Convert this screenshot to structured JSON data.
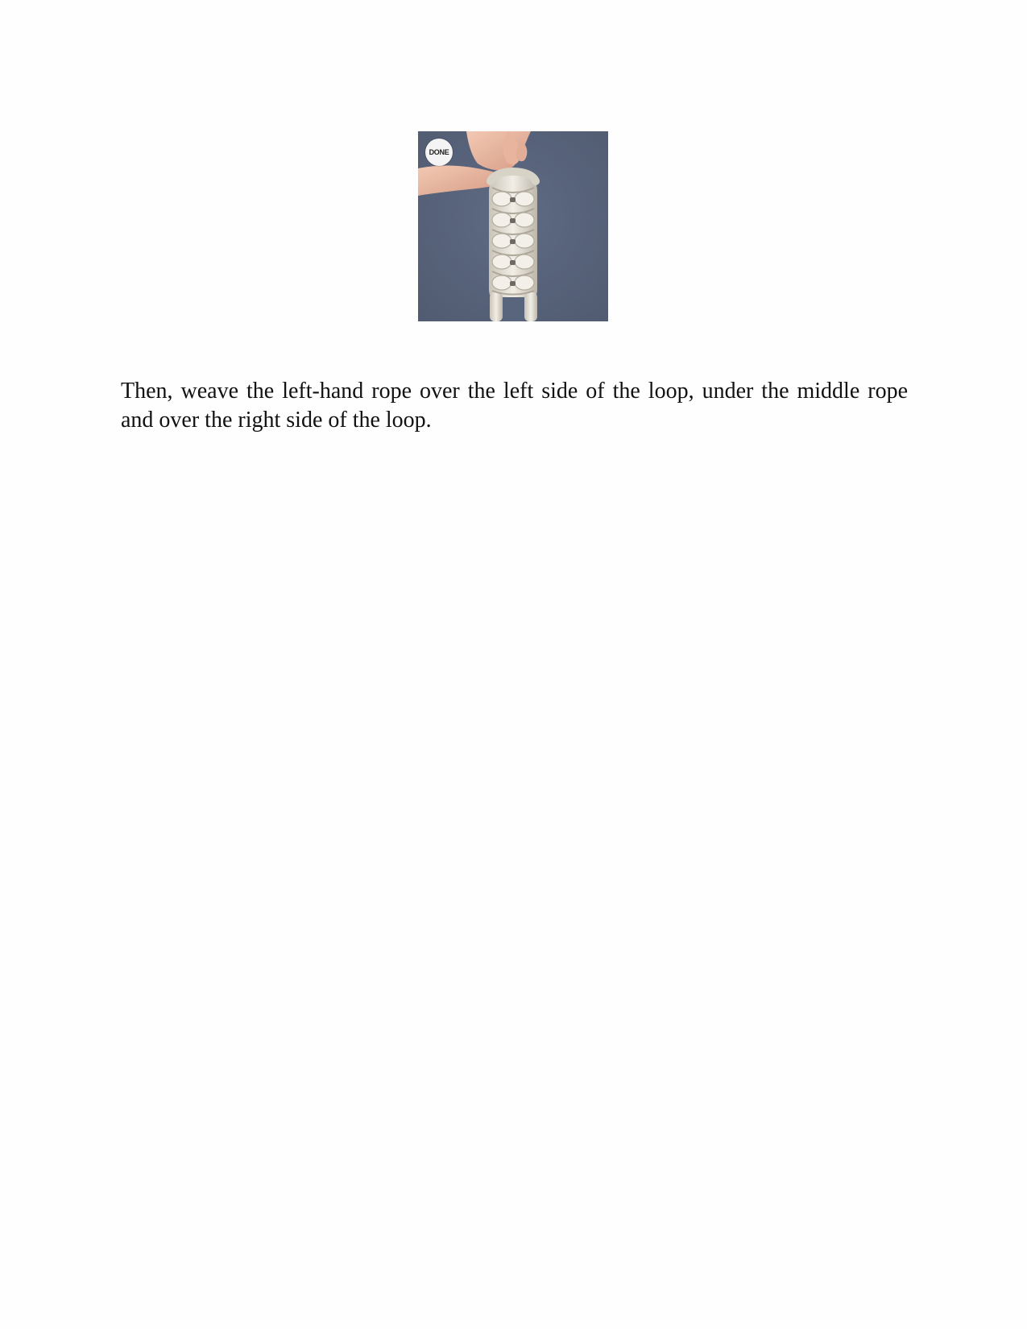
{
  "figure": {
    "badge_label": "DONE",
    "background_color": "#59657d",
    "rope_color": "#e6e2d8"
  },
  "paragraph": {
    "text": "Then, weave the left-hand rope over the left side of the loop, under the middle rope and over the right side of the loop."
  }
}
